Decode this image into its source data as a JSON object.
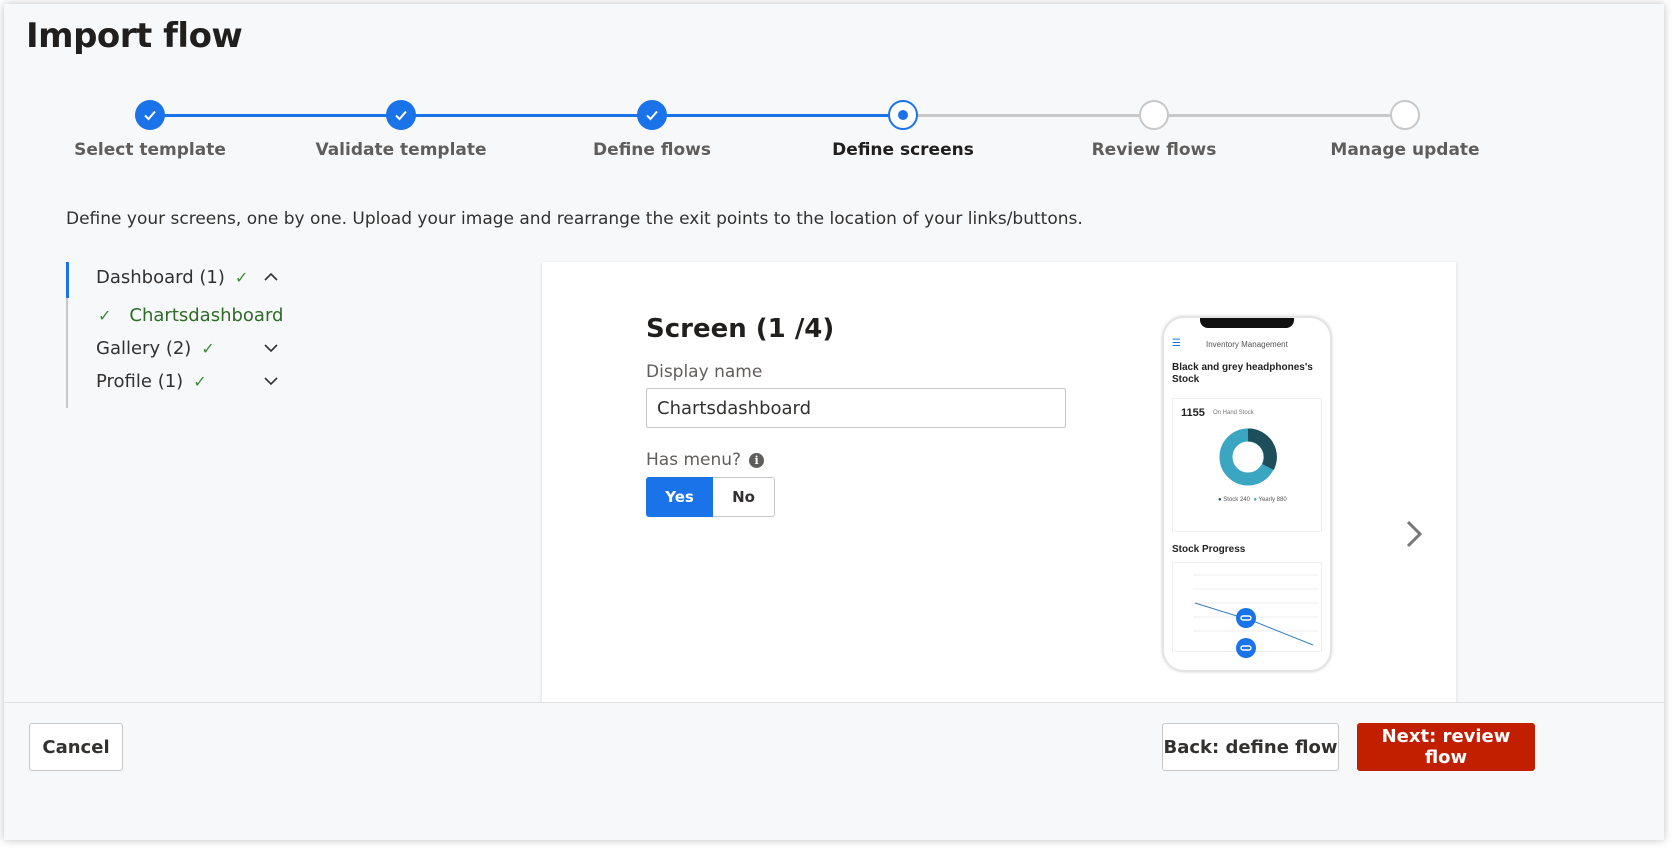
{
  "dialog": {
    "title": "Import flow",
    "description": "Define your screens, one by one. Upload your image and rearrange the exit points to the location of your links/buttons."
  },
  "stepper": {
    "steps": [
      {
        "label": "Select template",
        "state": "done"
      },
      {
        "label": "Validate template",
        "state": "done"
      },
      {
        "label": "Define flows",
        "state": "done"
      },
      {
        "label": "Define screens",
        "state": "current"
      },
      {
        "label": "Review flows",
        "state": "todo"
      },
      {
        "label": "Manage update",
        "state": "todo"
      }
    ]
  },
  "tree": {
    "groups": [
      {
        "label": "Dashboard (1)",
        "expanded": true,
        "children": [
          {
            "label": "Chartsdashboard"
          }
        ]
      },
      {
        "label": "Gallery (2)",
        "expanded": false
      },
      {
        "label": "Profile (1)",
        "expanded": false
      }
    ]
  },
  "screen": {
    "title": "Screen (1 /4)",
    "display_name_label": "Display name",
    "display_name_value": "Chartsdashboard",
    "has_menu_label": "Has menu?",
    "yes_label": "Yes",
    "no_label": "No",
    "has_menu_selected": "Yes"
  },
  "preview": {
    "app_name": "Inventory Management",
    "heading": "Black and grey headphones's Stock",
    "stock_number": "1155",
    "stock_label": "On Hand Stock",
    "legend_stock": "Stock 240",
    "legend_yearly": "Yearly 880",
    "section_title": "Stock Progress"
  },
  "footer": {
    "cancel_label": "Cancel",
    "back_label": "Back: define flow",
    "next_label": "Next: review flow"
  },
  "colors": {
    "accent": "#1a73e8",
    "primary_button": "#c21e00",
    "check_green": "#3d8b37"
  }
}
